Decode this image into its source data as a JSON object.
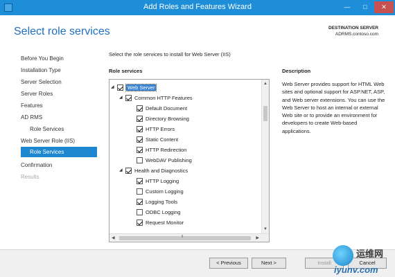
{
  "window": {
    "title": "Add Roles and Features Wizard",
    "controls": {
      "minimize": "—",
      "maximize": "□",
      "close": "✕"
    }
  },
  "header": {
    "page_title": "Select role services",
    "destination_label": "DESTINATION SERVER",
    "destination_server": "ADRMS.contoso.com"
  },
  "nav": {
    "items": [
      {
        "label": "Before You Begin",
        "state": "normal"
      },
      {
        "label": "Installation Type",
        "state": "normal"
      },
      {
        "label": "Server Selection",
        "state": "normal"
      },
      {
        "label": "Server Roles",
        "state": "normal"
      },
      {
        "label": "Features",
        "state": "normal"
      },
      {
        "label": "AD RMS",
        "state": "normal"
      },
      {
        "label": "Role Services",
        "state": "sub"
      },
      {
        "label": "Web Server Role (IIS)",
        "state": "normal"
      },
      {
        "label": "Role Services",
        "state": "active"
      },
      {
        "label": "Confirmation",
        "state": "normal"
      },
      {
        "label": "Results",
        "state": "disabled"
      }
    ]
  },
  "main": {
    "instruction": "Select the role services to install for Web Server (IIS)",
    "role_services_label": "Role services",
    "tree": [
      {
        "label": "Web Server",
        "checked": true,
        "level": 0,
        "expanded": true,
        "selected": true
      },
      {
        "label": "Common HTTP Features",
        "checked": true,
        "level": 1,
        "expanded": true
      },
      {
        "label": "Default Document",
        "checked": true,
        "level": 2
      },
      {
        "label": "Directory Browsing",
        "checked": true,
        "level": 2
      },
      {
        "label": "HTTP Errors",
        "checked": true,
        "level": 2
      },
      {
        "label": "Static Content",
        "checked": true,
        "level": 2
      },
      {
        "label": "HTTP Redirection",
        "checked": true,
        "level": 2
      },
      {
        "label": "WebDAV Publishing",
        "checked": false,
        "level": 2
      },
      {
        "label": "Health and Diagnostics",
        "checked": true,
        "level": 1,
        "expanded": true
      },
      {
        "label": "HTTP Logging",
        "checked": true,
        "level": 2
      },
      {
        "label": "Custom Logging",
        "checked": false,
        "level": 2
      },
      {
        "label": "Logging Tools",
        "checked": true,
        "level": 2
      },
      {
        "label": "ODBC Logging",
        "checked": false,
        "level": 2
      },
      {
        "label": "Request Monitor",
        "checked": true,
        "level": 2
      }
    ],
    "description_label": "Description",
    "description_text": "Web Server provides support for HTML Web sites and optional support for ASP.NET, ASP, and Web server extensions. You can use the Web Server to host an internal or external Web site or to provide an environment for developers to create Web-based applications."
  },
  "footer": {
    "previous": "< Previous",
    "next": "Next >",
    "install": "Install",
    "cancel": "Cancel"
  },
  "watermark": {
    "text1": "运维网",
    "text2": "iyunv.com"
  },
  "colors": {
    "titlebar": "#1e8ed8",
    "accent": "#1c86d0",
    "page_title": "#1e6fc0"
  }
}
